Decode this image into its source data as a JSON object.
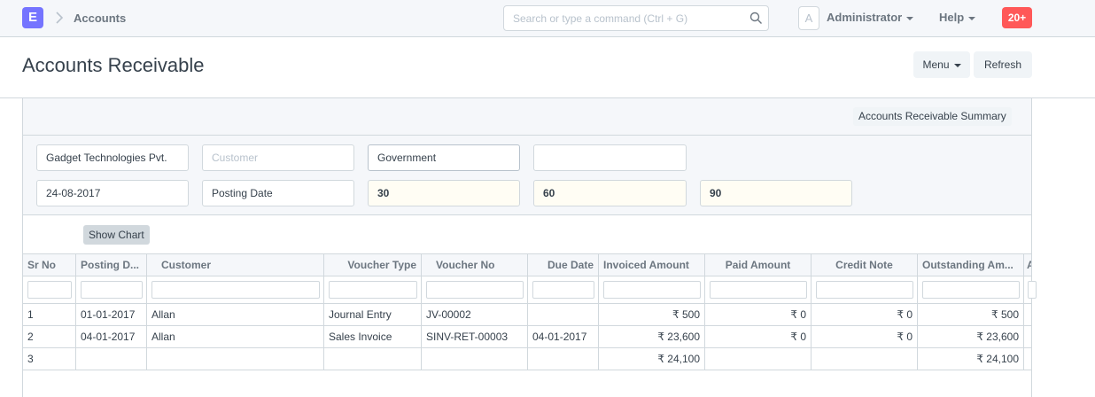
{
  "navbar": {
    "logo_letter": "E",
    "breadcrumb": "Accounts",
    "search_placeholder": "Search or type a command (Ctrl + G)",
    "avatar_letter": "A",
    "user_label": "Administrator",
    "help_label": "Help",
    "notification_count": "20+"
  },
  "page": {
    "title": "Accounts Receivable",
    "menu_label": "Menu",
    "refresh_label": "Refresh"
  },
  "report": {
    "summary_label": "Accounts Receivable Summary",
    "show_chart_label": "Show Chart",
    "filters": {
      "company": "Gadget Technologies Pvt.",
      "customer_placeholder": "Customer",
      "customer_group": "Government",
      "empty_filter": "",
      "report_date": "24-08-2017",
      "ageing_based_on": "Posting Date",
      "range1": "30",
      "range2": "60",
      "range3": "90"
    },
    "columns": [
      "Sr No",
      "Posting D...",
      "Customer",
      "Voucher Type",
      "Voucher No",
      "Due Date",
      "Invoiced Amount",
      "Paid Amount",
      "Credit Note",
      "Outstanding Am...",
      "A"
    ],
    "rows": [
      [
        "1",
        "01-01-2017",
        "Allan",
        "Journal Entry",
        "JV-00002",
        "",
        "₹ 500",
        "₹ 0",
        "₹ 0",
        "₹ 500"
      ],
      [
        "2",
        "04-01-2017",
        "Allan",
        "Sales Invoice",
        "SINV-RET-00003",
        "04-01-2017",
        "₹ 23,600",
        "₹ 0",
        "₹ 0",
        "₹ 23,600"
      ],
      [
        "3",
        "",
        "",
        "",
        "",
        "",
        "₹ 24,100",
        "",
        "",
        "₹ 24,100"
      ]
    ]
  }
}
